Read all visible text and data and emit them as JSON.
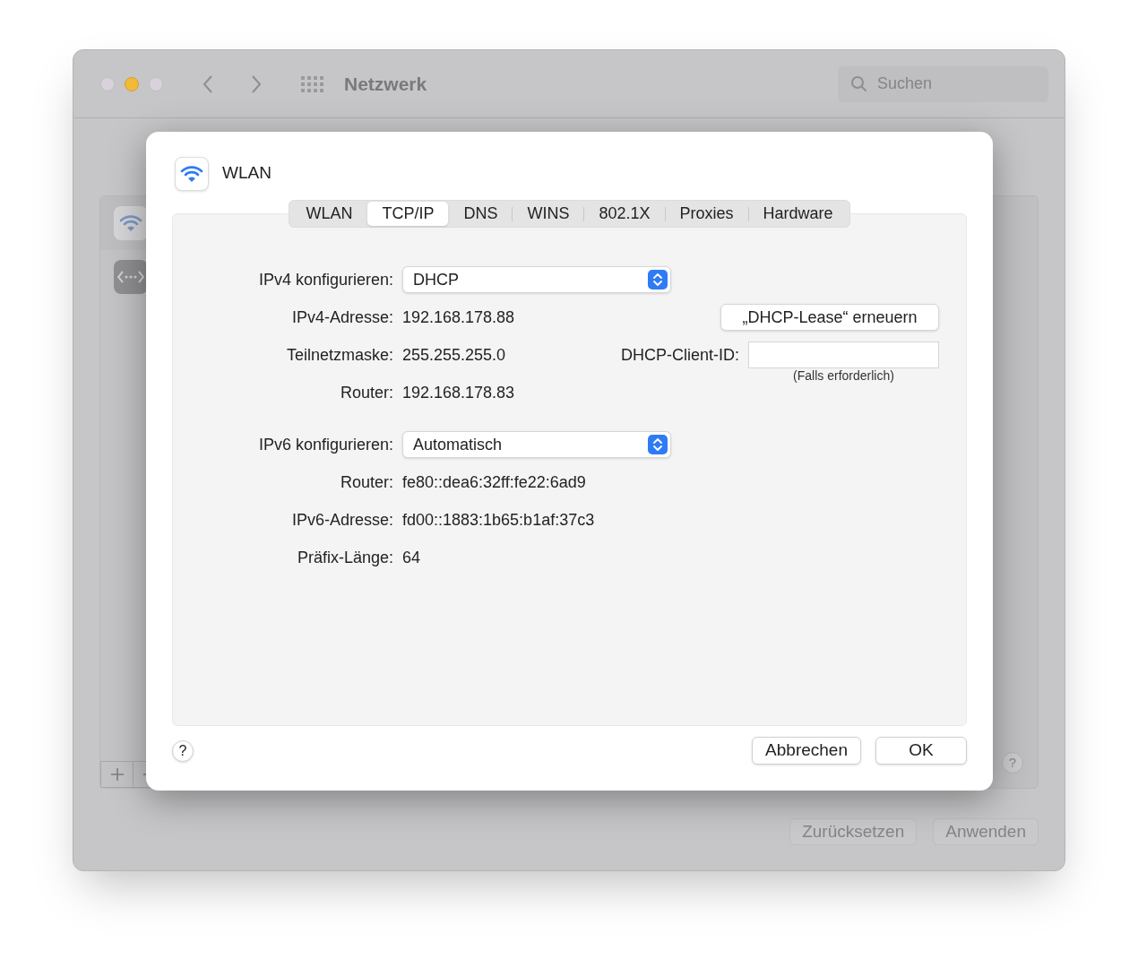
{
  "window": {
    "title": "Netzwerk",
    "search": {
      "placeholder": "Suchen"
    },
    "help": "?",
    "buttons": [
      {
        "label": "Zurücksetzen",
        "disabled": true
      },
      {
        "label": "Anwenden",
        "disabled": true
      }
    ]
  },
  "sheet": {
    "service": "WLAN",
    "tabs": [
      {
        "label": "WLAN",
        "selected": false
      },
      {
        "label": "TCP/IP",
        "selected": true
      },
      {
        "label": "DNS",
        "selected": false
      },
      {
        "label": "WINS",
        "selected": false
      },
      {
        "label": "802.1X",
        "selected": false
      },
      {
        "label": "Proxies",
        "selected": false
      },
      {
        "label": "Hardware",
        "selected": false
      }
    ],
    "ipv4": {
      "label": "IPv4 konfigurieren:",
      "value": "DHCP"
    },
    "ipv4_rows": [
      {
        "label": "IPv4-Adresse:",
        "value": "192.168.178.88"
      },
      {
        "label": "Teilnetzmaske:",
        "value": "255.255.255.0"
      },
      {
        "label": "Router:",
        "value": "192.168.178.83"
      }
    ],
    "renew_button": "„DHCP-Lease“ erneuern",
    "client_id": {
      "label": "DHCP-Client-ID:",
      "hint": "(Falls erforderlich)"
    },
    "ipv6": {
      "label": "IPv6 konfigurieren:",
      "value": "Automatisch"
    },
    "ipv6_rows": [
      {
        "label": "Router:",
        "value": "fe80::dea6:32ff:fe22:6ad9"
      },
      {
        "label": "IPv6-Adresse:",
        "value": "fd00::1883:1b65:b1af:37c3"
      },
      {
        "label": "Präfix-Länge:",
        "value": "64"
      }
    ],
    "help": "?",
    "buttons": [
      "Abbrechen",
      "OK"
    ]
  }
}
